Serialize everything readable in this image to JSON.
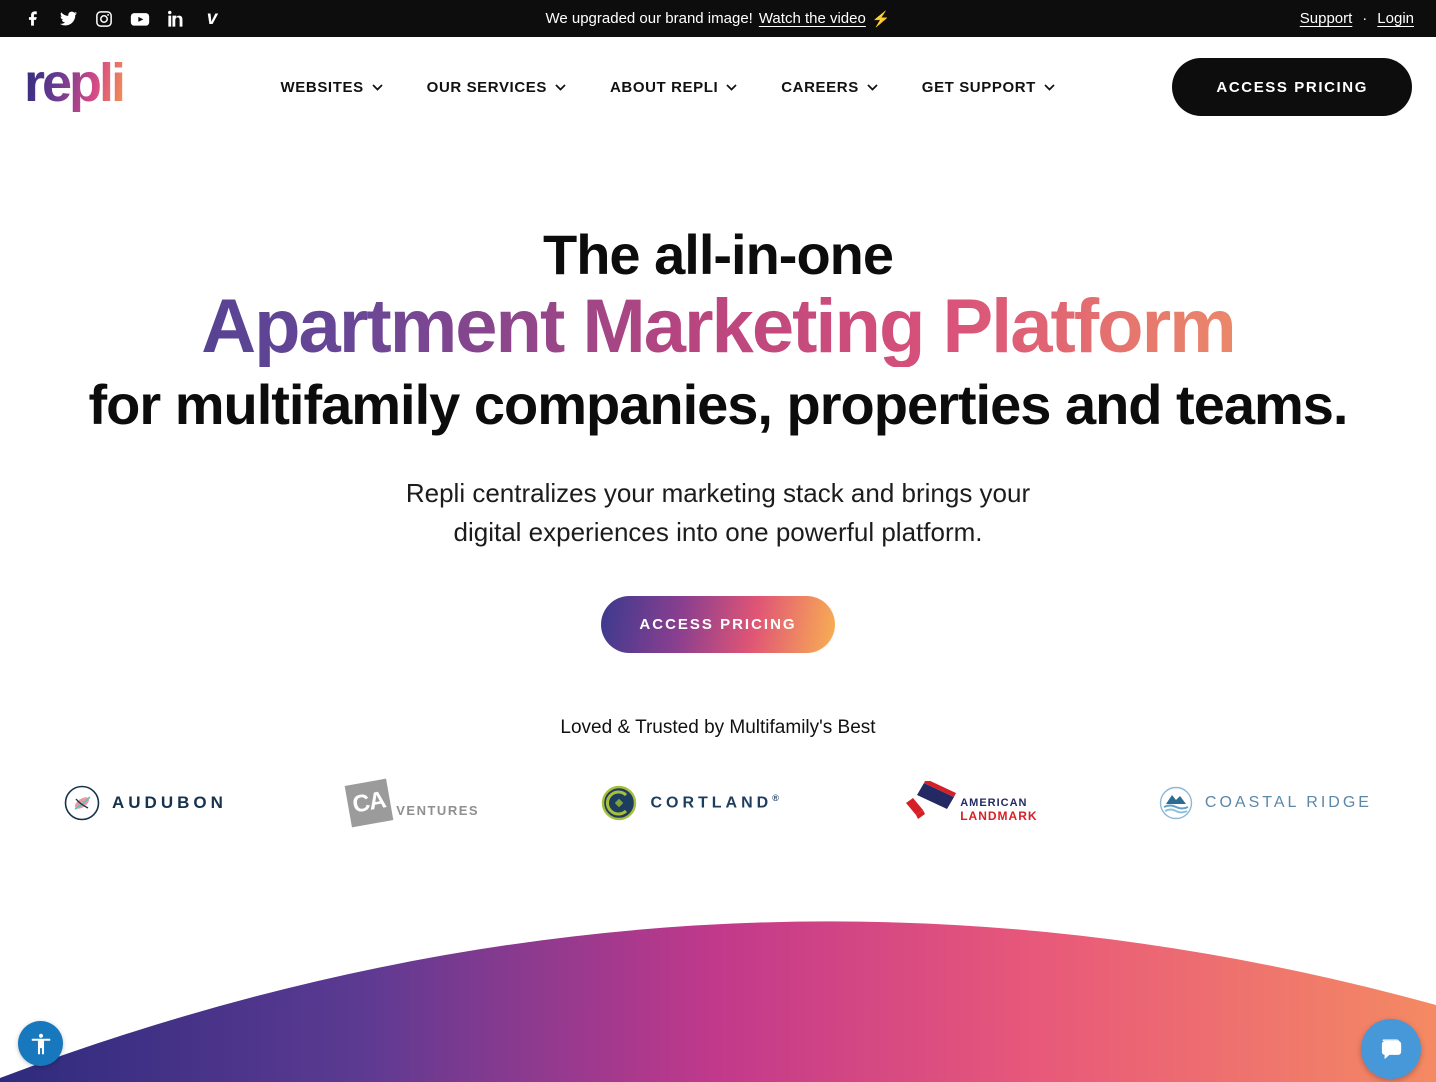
{
  "topbar": {
    "social": [
      {
        "name": "facebook"
      },
      {
        "name": "twitter"
      },
      {
        "name": "instagram"
      },
      {
        "name": "youtube"
      },
      {
        "name": "linkedin"
      },
      {
        "name": "vimeo"
      }
    ],
    "announcement_text": "We upgraded our brand image!",
    "announcement_link": "Watch the video",
    "announcement_emoji": "⚡",
    "support_label": "Support",
    "separator": "·",
    "login_label": "Login"
  },
  "header": {
    "logo_text": "repli",
    "nav": [
      {
        "label": "WEBSITES"
      },
      {
        "label": "OUR SERVICES"
      },
      {
        "label": "ABOUT REPLI"
      },
      {
        "label": "CAREERS"
      },
      {
        "label": "GET SUPPORT"
      }
    ],
    "cta_label": "ACCESS PRICING"
  },
  "hero": {
    "title_line1": "The all-in-one",
    "title_line2": "Apartment Marketing Platform",
    "title_line3": "for multifamily companies, properties and teams.",
    "subtitle_line1": "Repli centralizes your marketing stack and brings your",
    "subtitle_line2": "digital experiences into one powerful platform.",
    "cta_label": "ACCESS PRICING",
    "trusted_text": "Loved & Trusted by Multifamily's Best"
  },
  "logos": {
    "audubon": {
      "label": "AUDUBON"
    },
    "ca_ventures": {
      "mark": "CA",
      "label": "VENTURES"
    },
    "cortland": {
      "label": "CORTLAND",
      "reg": "®"
    },
    "american_landmark": {
      "line1": "AMERICAN",
      "line2": "LANDMARK"
    },
    "coastal_ridge": {
      "label": "COASTAL RIDGE"
    }
  },
  "colors": {
    "topbar_bg": "#0d0d0d",
    "header_cta_bg": "#0d0d0d",
    "brand_gradient_start": "#2f2a7b",
    "brand_gradient_mid": "#d64a86",
    "brand_gradient_end": "#f4964f",
    "hero_gradient_start": "#3e3d8f",
    "hero_gradient_mid": "#d9527a",
    "hero_gradient_end": "#f4a964",
    "wave_gradient_start": "#2e2b7d",
    "wave_gradient_mid": "#c2398b",
    "wave_gradient_end": "#f48a63",
    "bolt_yellow": "#f5c518",
    "accessibility_blue": "#1878be",
    "chat_blue": "#4698d8"
  }
}
